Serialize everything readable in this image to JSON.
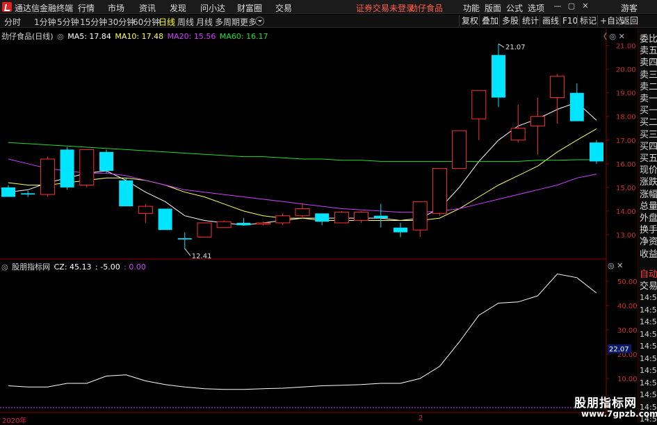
{
  "titlebar": {
    "app_name": "通达信金融终端",
    "menus": [
      "行情",
      "市场",
      "资讯",
      "发现",
      "问小达",
      "财富圈",
      "交易"
    ],
    "alert": "证券交易未登录",
    "stock_name": "劲仔食品",
    "right_menus": [
      "功能",
      "版面",
      "公式",
      "选项"
    ],
    "user": "游客",
    "window_buttons": [
      "—",
      "▢",
      "✕"
    ]
  },
  "toolbar": {
    "periods": [
      "分时",
      "1分钟",
      "5分钟",
      "15分钟",
      "30分钟",
      "60分钟",
      "日线",
      "周线",
      "月线",
      "多周期",
      "更多"
    ],
    "active_period": "日线",
    "right_buttons": [
      "复权",
      "叠加",
      "多股",
      "统计",
      "画线",
      "F10",
      "标记",
      "+自选",
      "返回"
    ]
  },
  "main_chart": {
    "title": "劲仔食品(日线)",
    "ma_labels": [
      {
        "text": "MA5: 17.84",
        "color": "#ffffff"
      },
      {
        "text": "MA10: 17.48",
        "color": "#ffff66"
      },
      {
        "text": "MA20: 15.56",
        "color": "#d040ff"
      },
      {
        "text": "MA60: 16.17",
        "color": "#22dd33"
      }
    ],
    "controls": "〈 ◎ ✕",
    "high_label": "21.07",
    "low_label": "12.41",
    "y_ticks": [
      "21.00",
      "20.00",
      "19.00",
      "18.00",
      "17.00",
      "16.00",
      "15.00",
      "14.00",
      "13.00"
    ]
  },
  "indicator": {
    "title": "股朋指标网",
    "labels": [
      {
        "text": "CZ: 45.13",
        "color": "#ffffff"
      },
      {
        "text": ": -5.00",
        "color": "#ffffff"
      },
      {
        "text": ": 0.00",
        "color": "#d040ff"
      }
    ],
    "controls": "◎ ✕",
    "y_ticks": [
      "50.00",
      "40.00",
      "30.00",
      "20.00",
      "10.00"
    ],
    "current_value": "22.07"
  },
  "quote_panel": {
    "items": [
      "委比",
      "卖五",
      "卖四",
      "卖三",
      "卖二",
      "卖一",
      "买一",
      "买二",
      "买三",
      "买四",
      "买五",
      "现价",
      "涨跌",
      "涨幅",
      "总量",
      "外盘",
      "换手",
      "净资",
      "收益"
    ],
    "auto_label": "自动",
    "trade_label": "交易",
    "times": [
      "14:56",
      "14:56",
      "14:56",
      "14:56",
      "14:56",
      "14:56",
      "14:56",
      "14:56",
      "14:56",
      "14:56",
      "14:56"
    ]
  },
  "x_axis": {
    "year_label": "2020年",
    "month_label": "2"
  },
  "watermark": {
    "name": "股朋指标网",
    "url": "www.7gpzb.com"
  },
  "colors": {
    "up": "#ff3030",
    "down": "#00e5ff",
    "ma5": "#ffffff",
    "ma10": "#ffff66",
    "ma20": "#d040ff",
    "ma60": "#22dd33",
    "axis": "#8a0000"
  },
  "chart_data": [
    {
      "type": "candlestick",
      "title": "劲仔食品(日线)",
      "ylim": [
        12.4,
        21.3
      ],
      "candles": [
        {
          "o": 15.0,
          "h": 15.1,
          "l": 14.6,
          "c": 14.6
        },
        {
          "o": 14.75,
          "h": 14.85,
          "l": 14.6,
          "c": 14.7
        },
        {
          "o": 14.7,
          "h": 16.3,
          "l": 14.6,
          "c": 16.2
        },
        {
          "o": 16.6,
          "h": 16.7,
          "l": 14.9,
          "c": 15.0
        },
        {
          "o": 15.1,
          "h": 16.6,
          "l": 15.0,
          "c": 16.6
        },
        {
          "o": 16.5,
          "h": 16.6,
          "l": 15.6,
          "c": 15.7
        },
        {
          "o": 15.3,
          "h": 15.4,
          "l": 14.2,
          "c": 14.2
        },
        {
          "o": 13.9,
          "h": 14.3,
          "l": 13.5,
          "c": 14.2
        },
        {
          "o": 14.1,
          "h": 14.1,
          "l": 13.2,
          "c": 13.2
        },
        {
          "o": 12.85,
          "h": 13.1,
          "l": 12.41,
          "c": 12.8
        },
        {
          "o": 12.9,
          "h": 13.5,
          "l": 12.9,
          "c": 13.5
        },
        {
          "o": 13.3,
          "h": 13.6,
          "l": 13.3,
          "c": 13.55
        },
        {
          "o": 13.5,
          "h": 13.7,
          "l": 13.4,
          "c": 13.4
        },
        {
          "o": 13.45,
          "h": 13.55,
          "l": 13.4,
          "c": 13.5
        },
        {
          "o": 13.5,
          "h": 13.9,
          "l": 13.4,
          "c": 13.8
        },
        {
          "o": 13.8,
          "h": 14.3,
          "l": 13.7,
          "c": 14.1
        },
        {
          "o": 13.9,
          "h": 13.9,
          "l": 13.4,
          "c": 13.55
        },
        {
          "o": 13.5,
          "h": 14.0,
          "l": 13.5,
          "c": 13.95
        },
        {
          "o": 13.6,
          "h": 14.0,
          "l": 13.5,
          "c": 13.95
        },
        {
          "o": 13.8,
          "h": 14.3,
          "l": 13.3,
          "c": 13.7
        },
        {
          "o": 13.3,
          "h": 13.5,
          "l": 12.9,
          "c": 13.1
        },
        {
          "o": 13.2,
          "h": 14.4,
          "l": 12.9,
          "c": 14.4
        },
        {
          "o": 13.9,
          "h": 15.8,
          "l": 13.8,
          "c": 15.8
        },
        {
          "o": 15.8,
          "h": 17.4,
          "l": 15.8,
          "c": 17.4
        },
        {
          "o": 17.9,
          "h": 19.1,
          "l": 17.0,
          "c": 19.1
        },
        {
          "o": 20.6,
          "h": 21.07,
          "l": 18.4,
          "c": 18.8
        },
        {
          "o": 17.0,
          "h": 18.5,
          "l": 16.9,
          "c": 17.5
        },
        {
          "o": 17.6,
          "h": 18.8,
          "l": 16.4,
          "c": 18.0
        },
        {
          "o": 18.8,
          "h": 19.8,
          "l": 17.7,
          "c": 19.7
        },
        {
          "o": 19.0,
          "h": 19.4,
          "l": 17.8,
          "c": 17.8
        },
        {
          "o": 16.9,
          "h": 17.0,
          "l": 16.0,
          "c": 16.1
        }
      ],
      "series": [
        {
          "name": "MA5",
          "values": [
            14.8,
            14.9,
            15.2,
            15.4,
            15.6,
            15.7,
            15.3,
            14.8,
            14.4,
            13.8,
            13.6,
            13.5,
            13.4,
            13.5,
            13.6,
            13.7,
            13.7,
            13.7,
            13.7,
            13.7,
            13.6,
            13.7,
            14.1,
            15.0,
            16.1,
            17.0,
            17.6,
            17.9,
            18.3,
            18.6,
            17.84
          ]
        },
        {
          "name": "MA10",
          "values": [
            15.2,
            15.1,
            15.1,
            15.2,
            15.3,
            15.4,
            15.4,
            15.3,
            15.1,
            14.8,
            14.6,
            14.3,
            14.0,
            13.8,
            13.7,
            13.7,
            13.6,
            13.6,
            13.6,
            13.6,
            13.6,
            13.6,
            13.7,
            14.1,
            14.6,
            15.1,
            15.5,
            15.9,
            16.5,
            17.0,
            17.48
          ]
        },
        {
          "name": "MA20",
          "values": [
            16.2,
            16.0,
            15.8,
            15.7,
            15.6,
            15.6,
            15.5,
            15.3,
            15.1,
            14.9,
            14.8,
            14.7,
            14.6,
            14.5,
            14.4,
            14.3,
            14.2,
            14.1,
            14.05,
            14.0,
            13.95,
            13.95,
            14.0,
            14.1,
            14.3,
            14.5,
            14.7,
            14.9,
            15.1,
            15.4,
            15.56
          ]
        },
        {
          "name": "MA60",
          "values": [
            16.9,
            16.85,
            16.8,
            16.75,
            16.7,
            16.65,
            16.6,
            16.55,
            16.5,
            16.45,
            16.4,
            16.35,
            16.3,
            16.3,
            16.25,
            16.2,
            16.2,
            16.15,
            16.15,
            16.1,
            16.1,
            16.1,
            16.1,
            16.1,
            16.1,
            16.1,
            16.1,
            16.15,
            16.15,
            16.17,
            16.17
          ]
        }
      ]
    },
    {
      "type": "line",
      "title": "股朋指标网",
      "ylim": [
        0,
        56
      ],
      "series": [
        {
          "name": "CZ",
          "values": [
            7.0,
            6.5,
            6.5,
            8.0,
            8.0,
            11.0,
            11.5,
            9.0,
            7.5,
            6.5,
            5.8,
            5.5,
            5.5,
            5.8,
            6.0,
            6.5,
            7.0,
            7.2,
            7.5,
            8.0,
            8.0,
            10.0,
            15.0,
            25.0,
            36.0,
            41.0,
            41.5,
            44.0,
            53.0,
            51.5,
            45.13
          ]
        },
        {
          "name": "",
          "values": [
            -5.0,
            -5.0
          ]
        }
      ]
    }
  ]
}
